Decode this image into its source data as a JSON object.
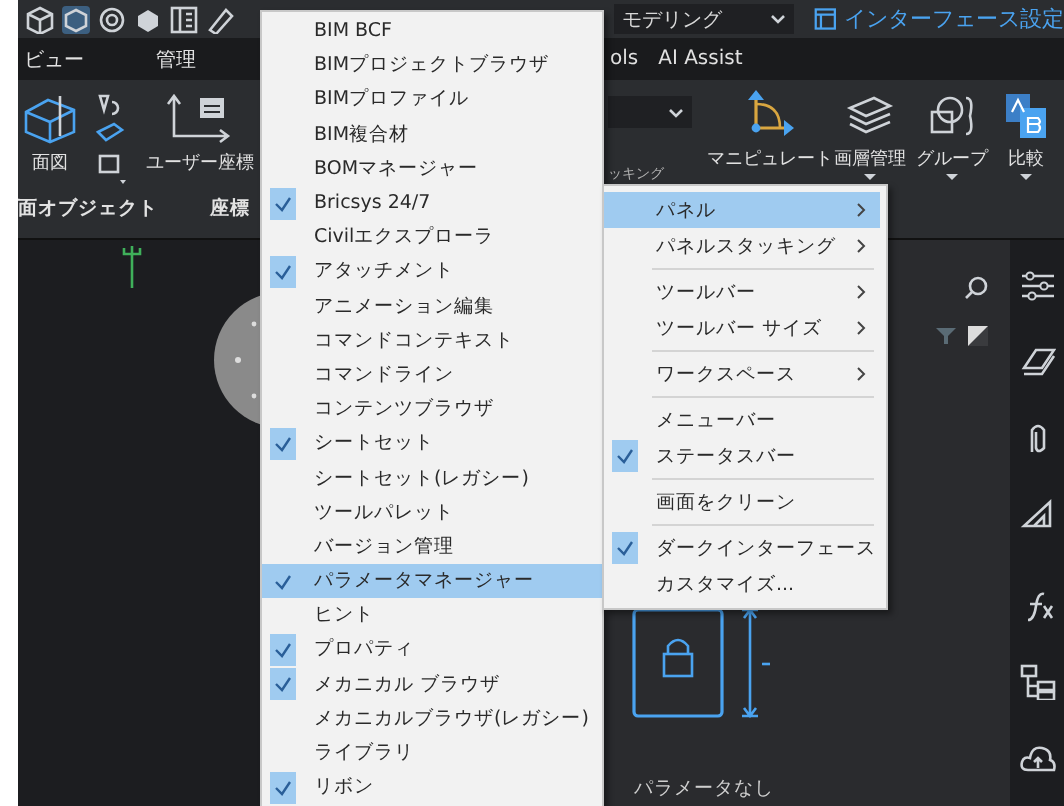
{
  "toolbar": {
    "workspace": "モデリング",
    "interface_settings": "インターフェース設定"
  },
  "ribbon_tabs": [
    {
      "label": "ビュー"
    },
    {
      "label": "管理"
    },
    {
      "label": "ols"
    },
    {
      "label": "AI Assist"
    }
  ],
  "ribbon_tools": [
    {
      "label": "面図"
    },
    {
      "label": "ユーザー座標"
    },
    {
      "label": "マニピュレート"
    },
    {
      "label": "画層管理"
    },
    {
      "label": "グループ"
    },
    {
      "label": "比較"
    }
  ],
  "ribbon_groups": [
    {
      "label": "面オブジェクト"
    },
    {
      "label": "座標"
    },
    {
      "label": "ッキング"
    }
  ],
  "context_menu": {
    "items": [
      {
        "label": "BIM BCF",
        "checked": false,
        "selected": false
      },
      {
        "label": "BIMプロジェクトブラウザ",
        "checked": false,
        "selected": false
      },
      {
        "label": "BIMプロファイル",
        "checked": false,
        "selected": false
      },
      {
        "label": "BIM複合材",
        "checked": false,
        "selected": false
      },
      {
        "label": "BOMマネージャー",
        "checked": false,
        "selected": false
      },
      {
        "label": "Bricsys 24/7",
        "checked": true,
        "selected": false
      },
      {
        "label": "Civilエクスプローラ",
        "checked": false,
        "selected": false
      },
      {
        "label": "アタッチメント",
        "checked": true,
        "selected": false
      },
      {
        "label": "アニメーション編集",
        "checked": false,
        "selected": false
      },
      {
        "label": "コマンドコンテキスト",
        "checked": false,
        "selected": false
      },
      {
        "label": "コマンドライン",
        "checked": false,
        "selected": false
      },
      {
        "label": "コンテンツブラウザ",
        "checked": false,
        "selected": false
      },
      {
        "label": "シートセット",
        "checked": true,
        "selected": false
      },
      {
        "label": "シートセット(レガシー)",
        "checked": false,
        "selected": false
      },
      {
        "label": "ツールパレット",
        "checked": false,
        "selected": false
      },
      {
        "label": "バージョン管理",
        "checked": false,
        "selected": false
      },
      {
        "label": "パラメータマネージャー",
        "checked": true,
        "selected": true
      },
      {
        "label": "ヒント",
        "checked": false,
        "selected": false
      },
      {
        "label": "プロパティ",
        "checked": true,
        "selected": false
      },
      {
        "label": "メカニカル ブラウザ",
        "checked": true,
        "selected": false
      },
      {
        "label": "メカニカルブラウザ(レガシー)",
        "checked": false,
        "selected": false
      },
      {
        "label": "ライブラリ",
        "checked": false,
        "selected": false
      },
      {
        "label": "リボン",
        "checked": true,
        "selected": false
      }
    ]
  },
  "submenu": {
    "items": [
      {
        "kind": "item",
        "label": "パネル",
        "has_submenu": true,
        "checked": false,
        "selected": true
      },
      {
        "kind": "item",
        "label": "パネルスタッキング",
        "has_submenu": true,
        "checked": false,
        "selected": false
      },
      {
        "kind": "separator"
      },
      {
        "kind": "item",
        "label": "ツールバー",
        "has_submenu": true,
        "checked": false,
        "selected": false
      },
      {
        "kind": "item",
        "label": "ツールバー サイズ",
        "has_submenu": true,
        "checked": false,
        "selected": false
      },
      {
        "kind": "separator"
      },
      {
        "kind": "item",
        "label": "ワークスペース",
        "has_submenu": true,
        "checked": false,
        "selected": false
      },
      {
        "kind": "separator"
      },
      {
        "kind": "item",
        "label": "メニューバー",
        "has_submenu": false,
        "checked": false,
        "selected": false
      },
      {
        "kind": "item",
        "label": "ステータスバー",
        "has_submenu": false,
        "checked": true,
        "selected": false
      },
      {
        "kind": "separator"
      },
      {
        "kind": "item",
        "label": "画面をクリーン",
        "has_submenu": false,
        "checked": false,
        "selected": false
      },
      {
        "kind": "separator"
      },
      {
        "kind": "item",
        "label": "ダークインターフェース",
        "has_submenu": false,
        "checked": true,
        "selected": false
      },
      {
        "kind": "item",
        "label": "カスタマイズ...",
        "has_submenu": false,
        "checked": false,
        "selected": false
      }
    ]
  },
  "parameters_panel": {
    "empty_text": "パラメータなし"
  }
}
